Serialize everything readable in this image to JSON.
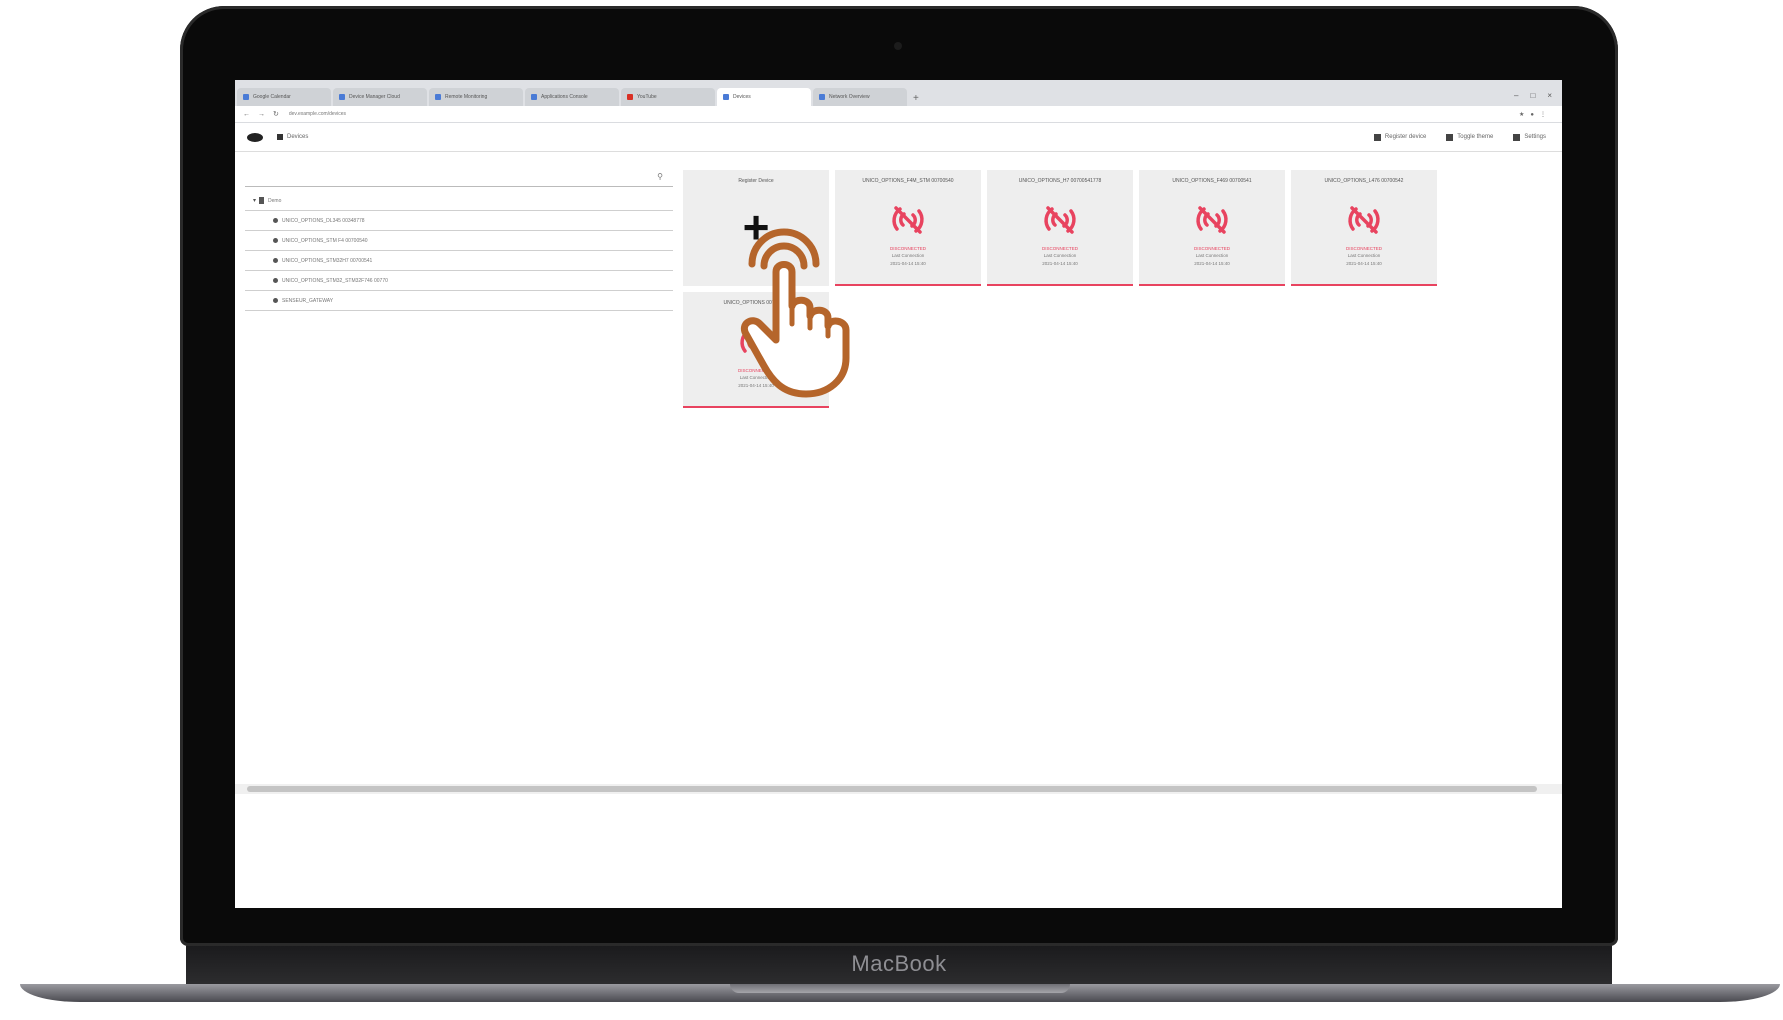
{
  "device": {
    "brand_label": "MacBook"
  },
  "browser": {
    "tabs": [
      {
        "label": "Google Calendar",
        "favicon": "page-icon"
      },
      {
        "label": "Device Manager Cloud",
        "favicon": "page-icon"
      },
      {
        "label": "Remote Monitoring",
        "favicon": "page-icon"
      },
      {
        "label": "Applications Console",
        "favicon": "page-icon"
      },
      {
        "label": "YouTube",
        "favicon": "video-icon"
      },
      {
        "label": "Devices",
        "favicon": "page-icon",
        "active": true
      },
      {
        "label": "Network Overview",
        "favicon": "page-icon"
      }
    ],
    "new_tab_label": "+",
    "url": "dev.example.com/devices"
  },
  "header": {
    "breadcrumb_label": "Devices",
    "actions": [
      {
        "label": "Register device",
        "icon": "device-icon"
      },
      {
        "label": "Toggle theme",
        "icon": "grid-icon"
      },
      {
        "label": "Settings",
        "icon": "gear-icon"
      }
    ]
  },
  "sidebar": {
    "search_placeholder": "",
    "root_label": "Demo",
    "items": [
      {
        "label": "UNICO_OPTIONS_DL345 00348778"
      },
      {
        "label": "UNICO_OPTIONS_STM F4 00700540"
      },
      {
        "label": "UNICO_OPTIONS_STM32H7 00700541"
      },
      {
        "label": "UNICO_OPTIONS_STM32_STM32F746 00770"
      },
      {
        "label": "SENSEUR_GATEWAY"
      }
    ]
  },
  "grid": {
    "register_card": {
      "title": "Register Device",
      "glyph": "+"
    },
    "devices": [
      {
        "title": "UNICO_OPTIONS_F4M_STM 00700540",
        "status": "DISCONNECTED",
        "info_1": "Last Connection",
        "info_2": "2021-04-14 15:40"
      },
      {
        "title": "UNICO_OPTIONS_H7 00700541778",
        "status": "DISCONNECTED",
        "info_1": "Last Connection",
        "info_2": "2021-04-14 15:40"
      },
      {
        "title": "UNICO_OPTIONS_F469 00700541",
        "status": "DISCONNECTED",
        "info_1": "Last Connection",
        "info_2": "2021-04-14 15:40"
      },
      {
        "title": "UNICO_OPTIONS_L476 00700542",
        "status": "DISCONNECTED",
        "info_1": "Last Connection",
        "info_2": "2021-04-14 15:40"
      },
      {
        "title": "UNICO_OPTIONS 00700543",
        "status": "DISCONNECTED",
        "info_1": "Last Connection",
        "info_2": "2021-04-14 15:40"
      }
    ]
  },
  "colors": {
    "disconnected": "#e8435f",
    "pointer": "#b5652b"
  }
}
